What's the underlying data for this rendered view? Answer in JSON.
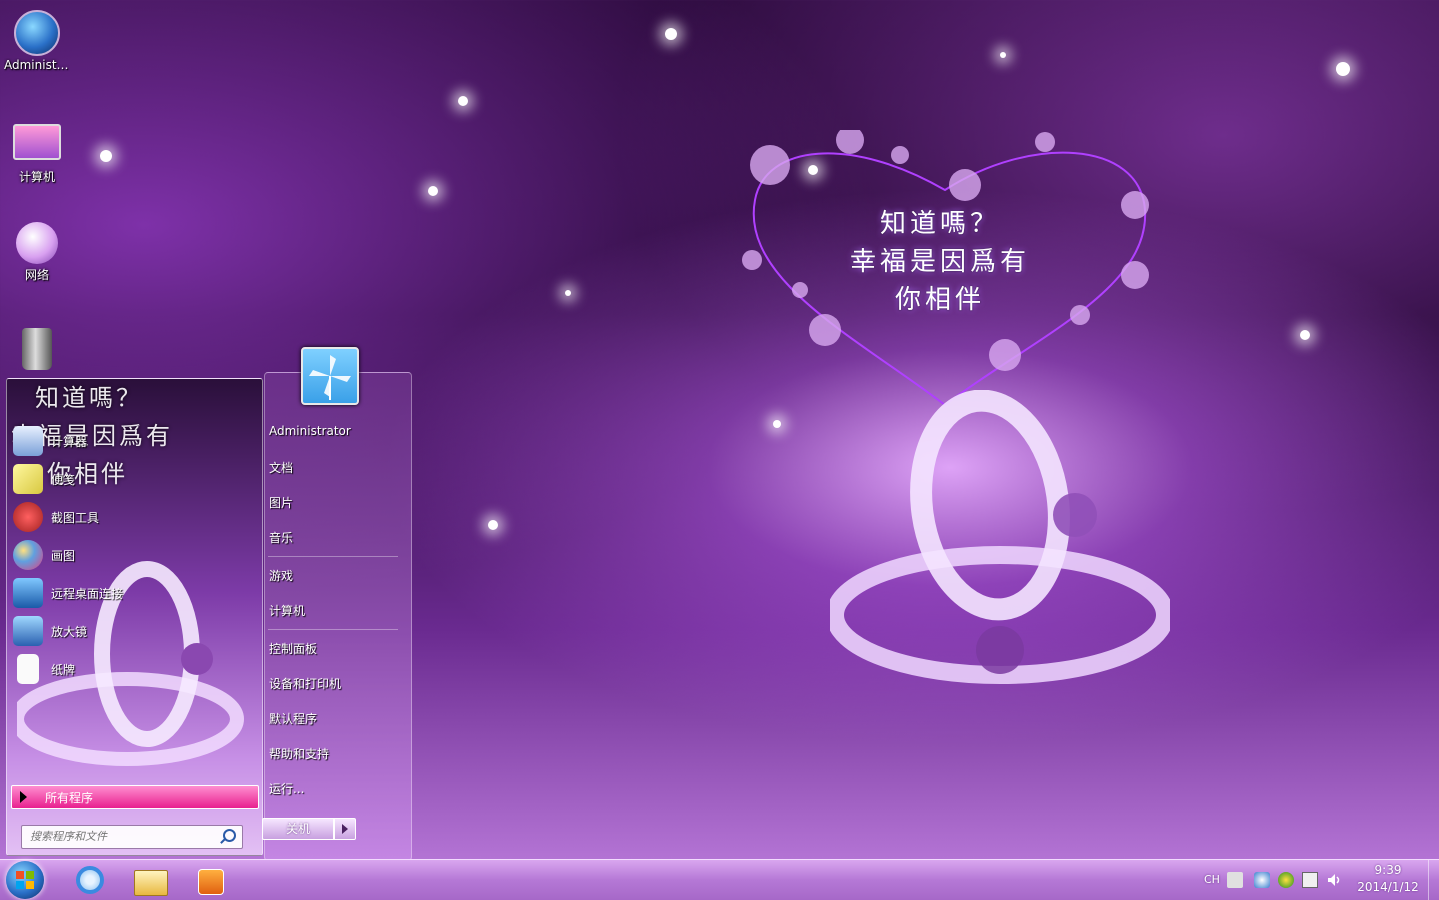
{
  "wallpaper": {
    "line1": "知道嗎？",
    "line2": "幸福是因爲有",
    "line3": "你相伴"
  },
  "desktop_icons": [
    {
      "label": "Administr...",
      "icon": "user-folder-icon"
    },
    {
      "label": "计算机",
      "icon": "computer-icon"
    },
    {
      "label": "网络",
      "icon": "network-icon"
    },
    {
      "label": "",
      "icon": "recycle-bin-icon"
    }
  ],
  "start_menu": {
    "promo_line1": "知道嗎？",
    "promo_line2": "幸福是因爲有",
    "promo_line3": "你相伴",
    "programs": [
      {
        "label": "计算器",
        "icon": "calculator-icon"
      },
      {
        "label": "便笺",
        "icon": "sticky-notes-icon"
      },
      {
        "label": "截图工具",
        "icon": "snipping-tool-icon"
      },
      {
        "label": "画图",
        "icon": "paint-icon"
      },
      {
        "label": "远程桌面连接",
        "icon": "remote-desktop-icon"
      },
      {
        "label": "放大镜",
        "icon": "magnifier-icon"
      },
      {
        "label": "纸牌",
        "icon": "solitaire-icon"
      }
    ],
    "all_programs": "所有程序",
    "search_placeholder": "搜索程序和文件",
    "right_items": {
      "user": "Administrator",
      "documents": "文档",
      "pictures": "图片",
      "music": "音乐",
      "games": "游戏",
      "computer": "计算机",
      "control_panel": "控制面板",
      "devices_printers": "设备和打印机",
      "default_programs": "默认程序",
      "help_support": "帮助和支持",
      "run": "运行..."
    },
    "shutdown": "关机"
  },
  "taskbar": {
    "pinned": [
      "internet-explorer-icon",
      "file-explorer-icon",
      "media-player-icon"
    ],
    "language": "CH",
    "time": "9:39",
    "date": "2014/1/12"
  },
  "colors": {
    "accent": "#e8208f",
    "taskbar": "#b578d6"
  }
}
